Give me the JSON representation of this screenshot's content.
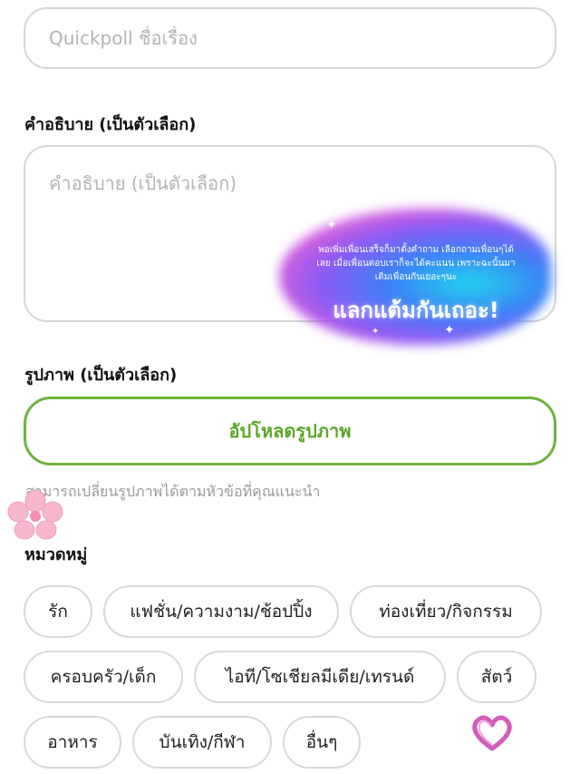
{
  "title_field": {
    "placeholder": "Quickpoll ชื่อเรื่อง"
  },
  "description": {
    "label": "คำอธิบาย (เป็นตัวเลือก)",
    "placeholder": "คำอธิบาย (เป็นตัวเลือก)"
  },
  "promo": {
    "small_text": "พอเพิ่มเพื่อนเสร็จก็มาตั้งคำถาม เลือกถามเพื่อนๆได้เลย เมื่อเพื่อนตอบเราก็จะได้คะแนน เพราะฉะนั้นมาเติมเพื่อนกันเยอะๆนะ",
    "big_text": "แลกแต้มกันเถอะ!"
  },
  "image": {
    "label": "รูปภาพ (เป็นตัวเลือก)",
    "upload_label": "อัปโหลดรูปภาพ",
    "hint": "สามารถเปลี่ยนรูปภาพได้ตามหัวข้อที่คุณแนะนำ"
  },
  "category": {
    "label": "หมวดหมู่",
    "chips": [
      "รัก",
      "แฟชั่น/ความงาม/ช้อปปิ้ง",
      "ท่องเที่ยว/กิจกรรม",
      "ครอบครัว/เด็ก",
      "ไอที/โซเชียลมีเดีย/เทรนด์",
      "สัตว์",
      "อาหาร",
      "บันเทิง/กีฬา",
      "อื่นๆ"
    ]
  },
  "colors": {
    "accent_green": "#5aa82a",
    "border": "#d8d8d8"
  }
}
